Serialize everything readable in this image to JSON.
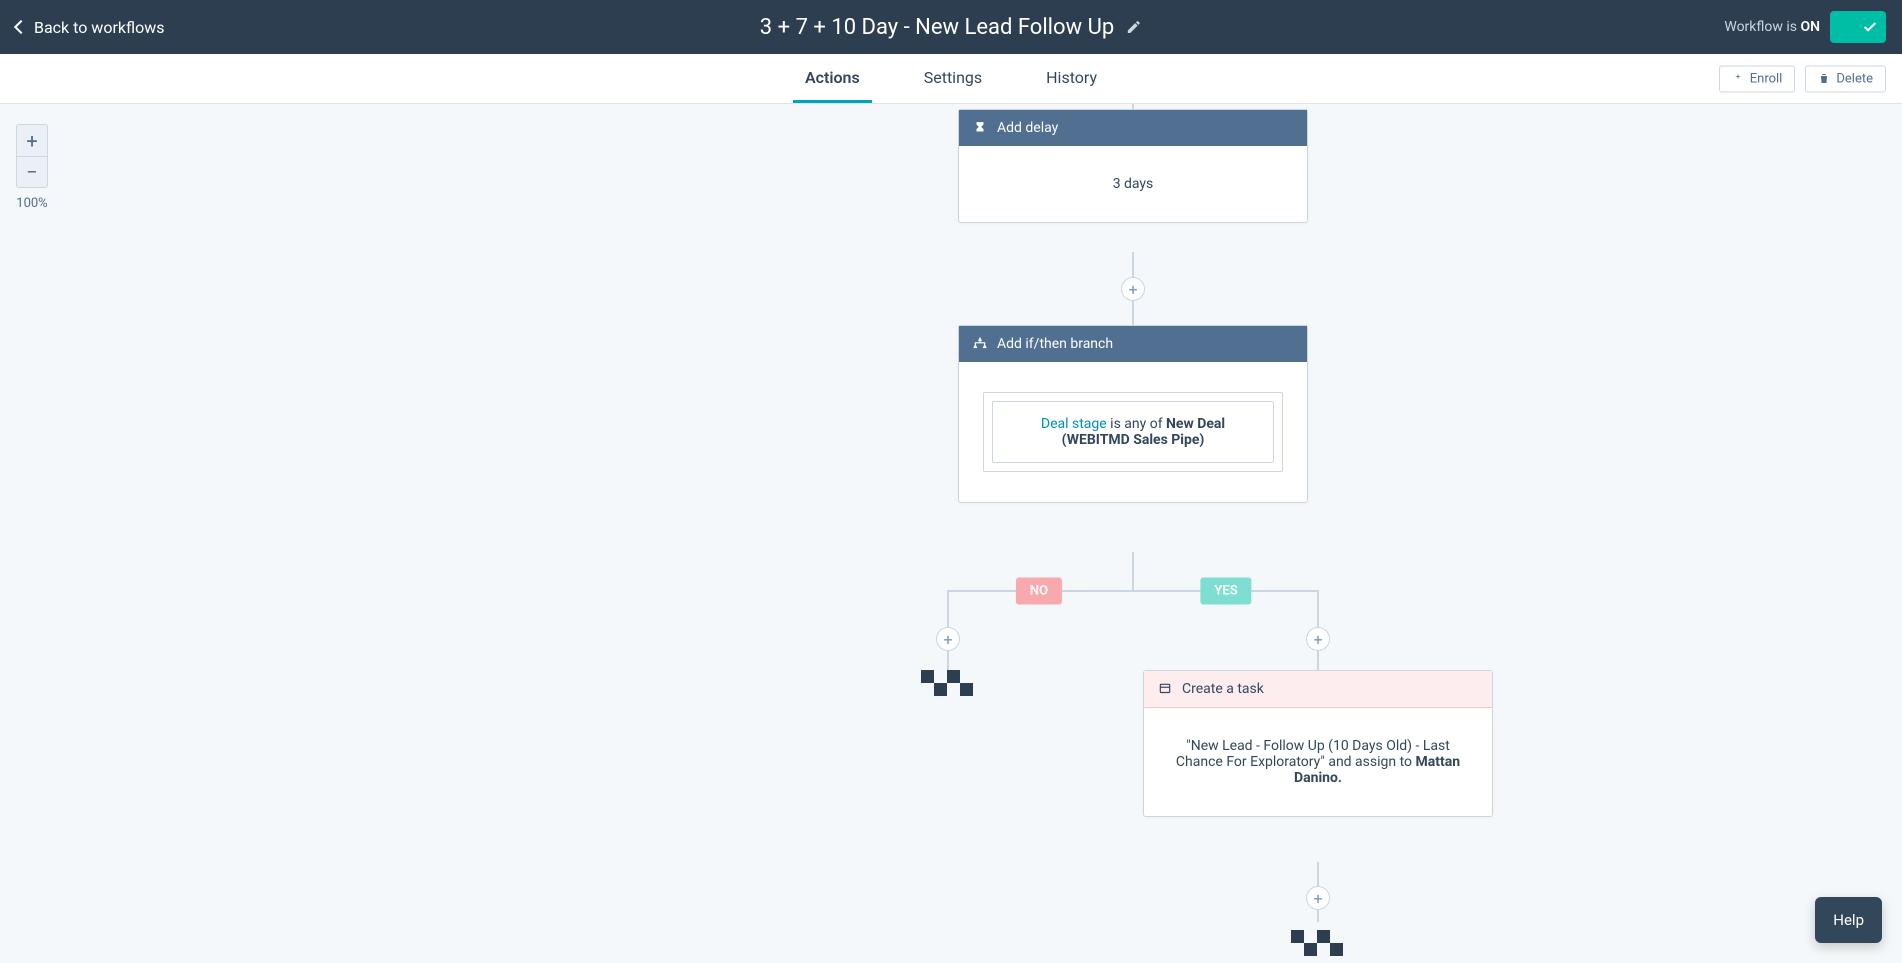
{
  "header": {
    "back_label": "Back to workflows",
    "title": "3 + 7 + 10 Day - New Lead Follow Up",
    "status_prefix": "Workflow is ",
    "status_value": "ON"
  },
  "tabs": {
    "actions": "Actions",
    "settings": "Settings",
    "history": "History"
  },
  "toolbar": {
    "enroll": "Enroll",
    "delete": "Delete"
  },
  "zoom": {
    "level": "100%"
  },
  "cards": {
    "delay_header": "Add delay",
    "delay_body": "3 days",
    "branch_header": "Add if/then branch",
    "branch_property": "Deal stage",
    "branch_middle": " is any of ",
    "branch_value": "New Deal (WEBITMD Sales Pipe)",
    "task_header": "Create a task",
    "task_quote": "\"New Lead - Follow Up (10 Days Old) - Last Chance For Exploratory\"",
    "task_middle": " and assign to ",
    "task_assignee": "Mattan Danino."
  },
  "branches": {
    "no": "NO",
    "yes": "YES"
  },
  "help": "Help"
}
